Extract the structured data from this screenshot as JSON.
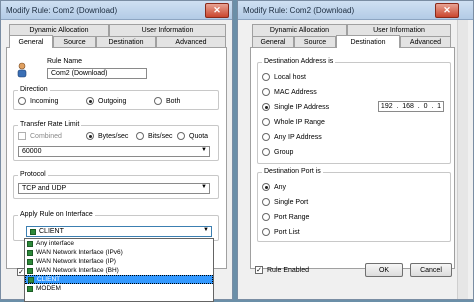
{
  "left_dialog": {
    "title": "Modify Rule: Com2 (Download)",
    "tabs_row1": [
      "Dynamic Allocation",
      "User Information"
    ],
    "tabs_row2": [
      "General",
      "Source",
      "Destination",
      "Advanced"
    ],
    "active_tab": "General",
    "rule_name_label": "Rule Name",
    "rule_name_value": "Com2 (Download)",
    "direction": {
      "label": "Direction",
      "options": [
        "Incoming",
        "Outgoing",
        "Both"
      ],
      "selected": "Outgoing"
    },
    "transfer": {
      "label": "Transfer Rate Limit",
      "combined_label": "Combined",
      "units": [
        "Bytes/sec",
        "Bits/sec",
        "Quota"
      ],
      "selected": "Bytes/sec",
      "value": "60000"
    },
    "protocol": {
      "label": "Protocol",
      "value": "TCP and UDP"
    },
    "interface": {
      "label": "Apply Rule on Interface",
      "value": "CLIENT",
      "options": [
        "Any interface",
        "WAN Network Interface (IPv6)",
        "WAN Network Interface (IP)",
        "WAN Network Interface (BH)",
        "CLIENT",
        "MODEM"
      ],
      "selected": "CLIENT"
    }
  },
  "right_dialog": {
    "title": "Modify Rule: Com2 (Download)",
    "tabs_row1": [
      "Dynamic Allocation",
      "User Information"
    ],
    "tabs_row2": [
      "General",
      "Source",
      "Destination",
      "Advanced"
    ],
    "active_tab": "Destination",
    "dest_address": {
      "label": "Destination Address is",
      "options": [
        "Local host",
        "MAC Address",
        "Single IP Address",
        "Whole IP Range",
        "Any IP Address",
        "Group"
      ],
      "selected": "Single IP Address",
      "ip": [
        "192",
        "168",
        "0",
        "1"
      ]
    },
    "dest_port": {
      "label": "Destination Port is",
      "options": [
        "Any",
        "Single Port",
        "Port Range",
        "Port List"
      ],
      "selected": "Any"
    },
    "rule_enabled_label": "Rule Enabled",
    "ok_label": "OK",
    "cancel_label": "Cancel"
  }
}
